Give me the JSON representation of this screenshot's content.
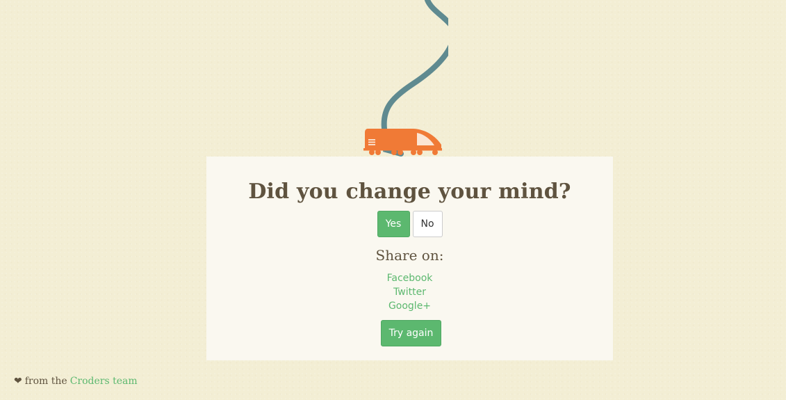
{
  "illustration": {
    "icon": "train-on-cord",
    "train_color": "#f07a36",
    "cord_color": "#5f8a90"
  },
  "card": {
    "headline": "Did you change your mind?",
    "yes_label": "Yes",
    "no_label": "No",
    "share_heading": "Share on:",
    "share_links": [
      "Facebook",
      "Twitter",
      "Google+"
    ],
    "try_again_label": "Try again"
  },
  "footer": {
    "heart_icon": "heart-icon",
    "prefix": "from the",
    "team_link": "Croders team"
  },
  "colors": {
    "background": "#f3eed4",
    "card": "#faf8f0",
    "accent": "#5cb86f",
    "text": "#5f533f"
  }
}
